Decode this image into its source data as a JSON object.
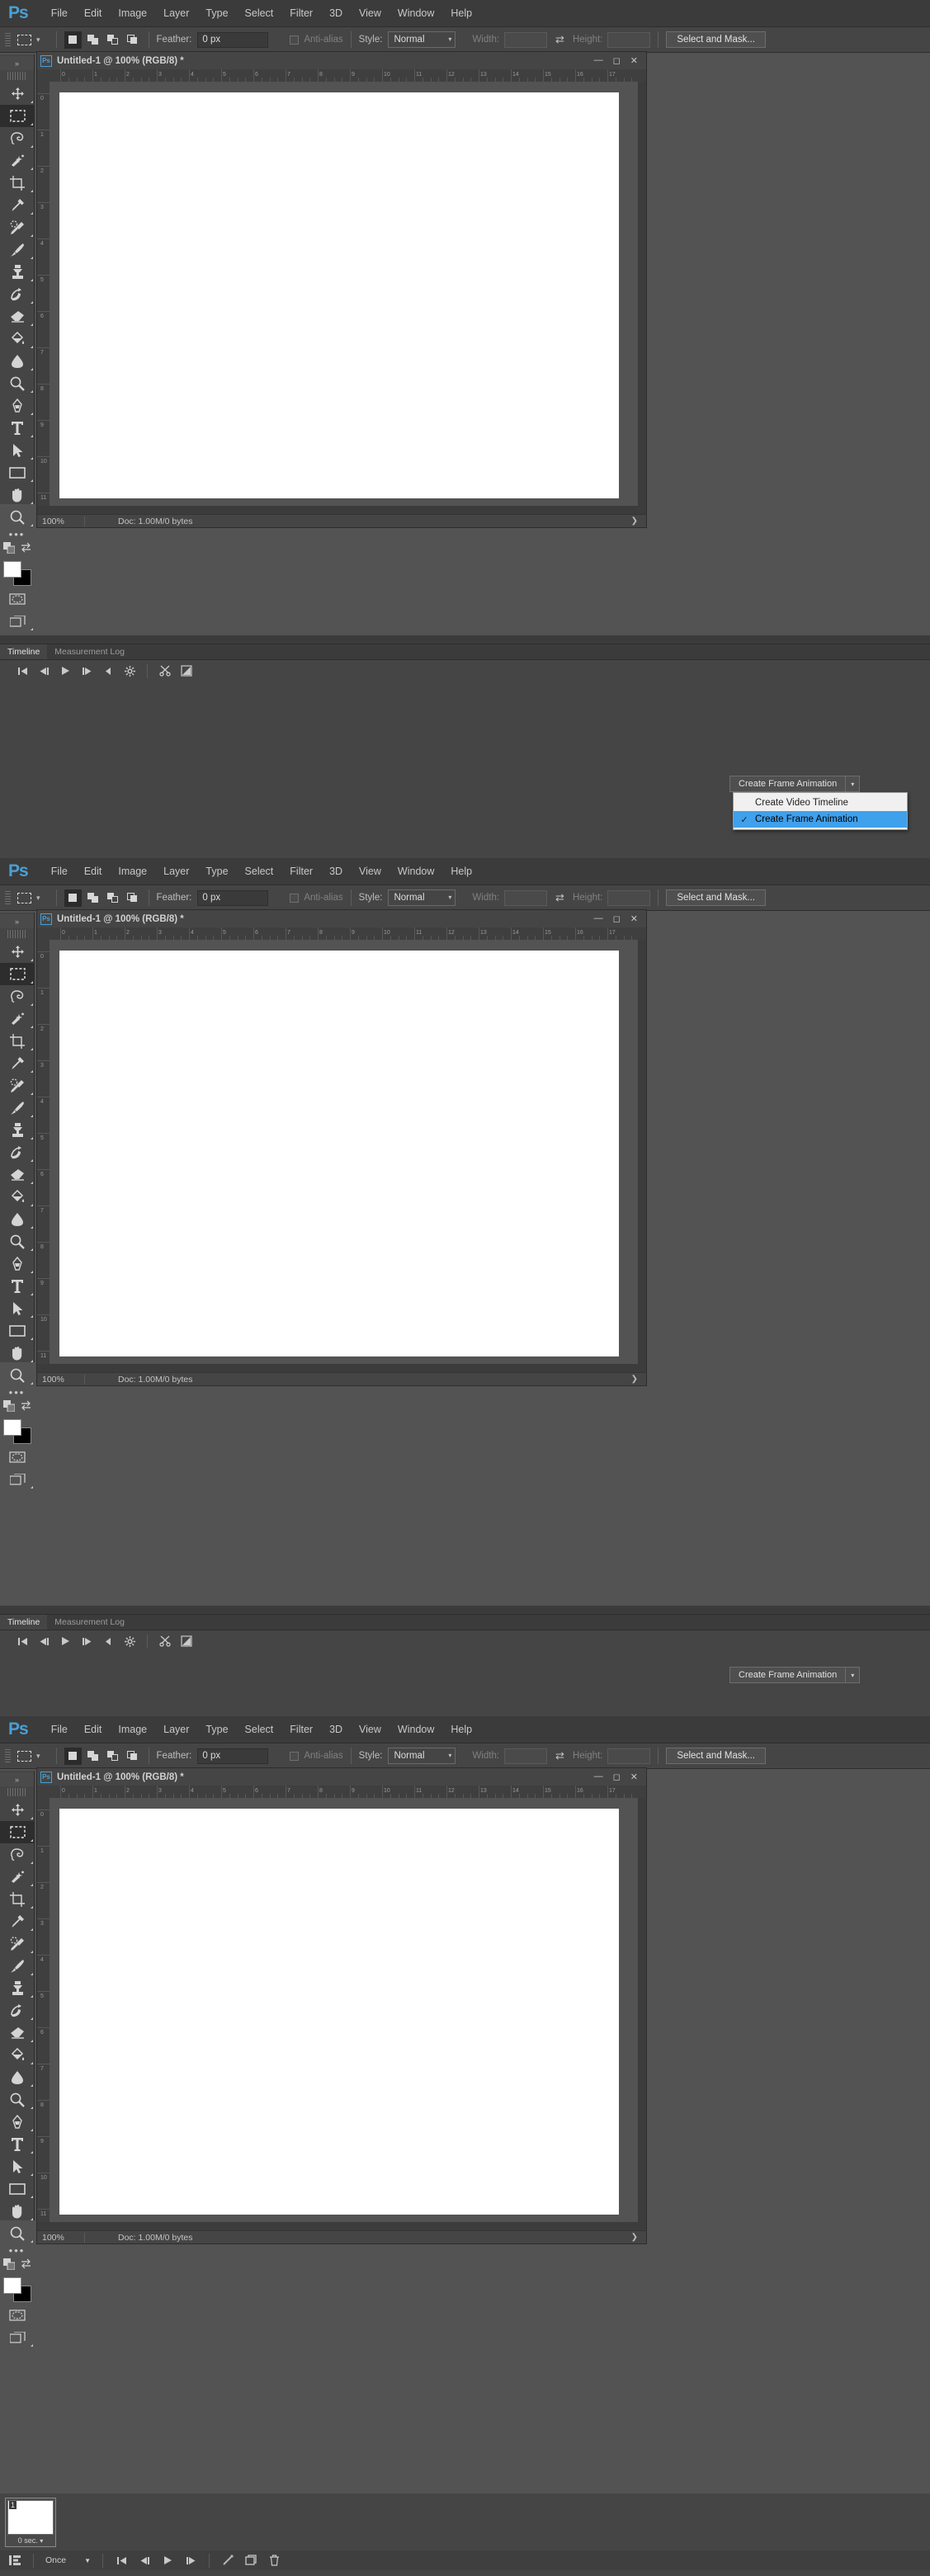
{
  "app": {
    "logo": "Ps",
    "menu": [
      "File",
      "Edit",
      "Image",
      "Layer",
      "Type",
      "Select",
      "Filter",
      "3D",
      "View",
      "Window",
      "Help"
    ]
  },
  "options_bar": {
    "tool_icon": "rectangular-marquee-icon",
    "bool_modes": [
      "new-selection",
      "add-to-selection",
      "subtract-from-selection",
      "intersect-with-selection"
    ],
    "feather_label": "Feather:",
    "feather_value": "0 px",
    "antialias_label": "Anti-alias",
    "style_label": "Style:",
    "style_value": "Normal",
    "width_label": "Width:",
    "width_value": "",
    "swap_icon": "swap-width-height-icon",
    "height_label": "Height:",
    "height_value": "",
    "select_and_mask": "Select and Mask..."
  },
  "toolbar": {
    "collapse_icon": "double-chevron-right-icon",
    "tools": [
      {
        "name": "move-tool",
        "icon": "move-icon"
      },
      {
        "name": "rectangular-marquee-tool",
        "icon": "marquee-icon",
        "active": true
      },
      {
        "name": "lasso-tool",
        "icon": "lasso-icon"
      },
      {
        "name": "quick-selection-tool",
        "icon": "magic-wand-icon"
      },
      {
        "name": "crop-tool",
        "icon": "crop-icon"
      },
      {
        "name": "eyedropper-tool",
        "icon": "eyedropper-icon"
      },
      {
        "name": "spot-healing-brush-tool",
        "icon": "healing-brush-icon"
      },
      {
        "name": "brush-tool",
        "icon": "brush-icon"
      },
      {
        "name": "clone-stamp-tool",
        "icon": "stamp-icon"
      },
      {
        "name": "history-brush-tool",
        "icon": "history-brush-icon"
      },
      {
        "name": "eraser-tool",
        "icon": "eraser-icon"
      },
      {
        "name": "gradient-tool",
        "icon": "paint-bucket-icon"
      },
      {
        "name": "blur-tool",
        "icon": "blur-drop-icon"
      },
      {
        "name": "dodge-tool",
        "icon": "dodge-icon"
      },
      {
        "name": "pen-tool",
        "icon": "pen-icon"
      },
      {
        "name": "type-tool",
        "icon": "type-t-icon"
      },
      {
        "name": "path-selection-tool",
        "icon": "arrow-pointer-icon"
      },
      {
        "name": "rectangle-tool",
        "icon": "rectangle-icon"
      },
      {
        "name": "hand-tool",
        "icon": "hand-icon"
      },
      {
        "name": "zoom-tool",
        "icon": "magnifier-icon"
      }
    ],
    "more_tools_icon": "ellipsis-icon",
    "edit_toolbar_icon": "edit-toolbar-icon",
    "default_colors_icon": "default-colors-icon",
    "swap_colors_icon": "swap-colors-icon",
    "foreground_color": "#ffffff",
    "background_color": "#000000",
    "quick_mask_icon": "quick-mask-icon",
    "screen_mode_icon": "screen-mode-icon"
  },
  "document": {
    "icon": "ps-document-icon",
    "title": "Untitled-1 @ 100% (RGB/8) *",
    "minimize": "minimize-icon",
    "maximize": "maximize-icon",
    "close": "close-icon",
    "zoom_level": "100%",
    "doc_info": "Doc: 1.00M/0 bytes",
    "status_arrow": "chevron-right-icon",
    "ruler_ticks": [
      "0",
      "1",
      "2",
      "3",
      "4",
      "5",
      "6",
      "7",
      "8",
      "9",
      "10",
      "11",
      "12",
      "13",
      "14",
      "15",
      "16",
      "17"
    ],
    "ruler_ticks_v": [
      "0",
      "1",
      "2",
      "3",
      "4",
      "5",
      "6",
      "7",
      "8",
      "9",
      "10",
      "11"
    ]
  },
  "timeline": {
    "tabs": [
      {
        "label": "Timeline",
        "active": true
      },
      {
        "label": "Measurement Log",
        "active": false
      }
    ],
    "video_controls": [
      {
        "name": "go-to-first-frame-button",
        "glyph": "|◀"
      },
      {
        "name": "previous-frame-button",
        "glyph": "◀|"
      },
      {
        "name": "play-button",
        "glyph": "▶"
      },
      {
        "name": "next-frame-button",
        "glyph": "|▶"
      },
      {
        "name": "audio-mute-button",
        "glyph": "◀"
      },
      {
        "name": "render-settings-button",
        "glyph": "⚙"
      },
      {
        "name": "split-at-playhead-button",
        "glyph": "✂"
      },
      {
        "name": "transition-button",
        "glyph": "◥"
      }
    ]
  },
  "create_animation": {
    "button_label": "Create Frame Animation",
    "dropdown_arrow": "chevron-down-icon",
    "menu_items": [
      {
        "label": "Create Video Timeline",
        "checked": false
      },
      {
        "label": "Create Frame Animation",
        "checked": true
      }
    ],
    "check_glyph": "✓",
    "highlight_color": "#3fa0ec"
  },
  "frame_animation": {
    "frames": [
      {
        "number": "1",
        "delay": "0 sec."
      }
    ],
    "delay_chevron": "chevron-down-icon",
    "convert_icon": "convert-to-video-timeline-icon",
    "loop_value": "Once",
    "loop_chevron": "▼",
    "controls": [
      {
        "name": "select-first-frame-button",
        "glyph": "|◀"
      },
      {
        "name": "select-previous-frame-button",
        "glyph": "◀|"
      },
      {
        "name": "play-animation-button",
        "glyph": "▶"
      },
      {
        "name": "select-next-frame-button",
        "glyph": "|▶"
      }
    ],
    "tween_icon": "tween-frames-icon",
    "duplicate_icon": "duplicate-frame-icon",
    "delete_icon": "delete-frame-icon"
  },
  "panels": [
    {
      "id": "panel-1",
      "state": "dropdown-open"
    },
    {
      "id": "panel-2",
      "state": "button-collapsed"
    },
    {
      "id": "panel-3",
      "state": "frame-animation-created"
    }
  ]
}
